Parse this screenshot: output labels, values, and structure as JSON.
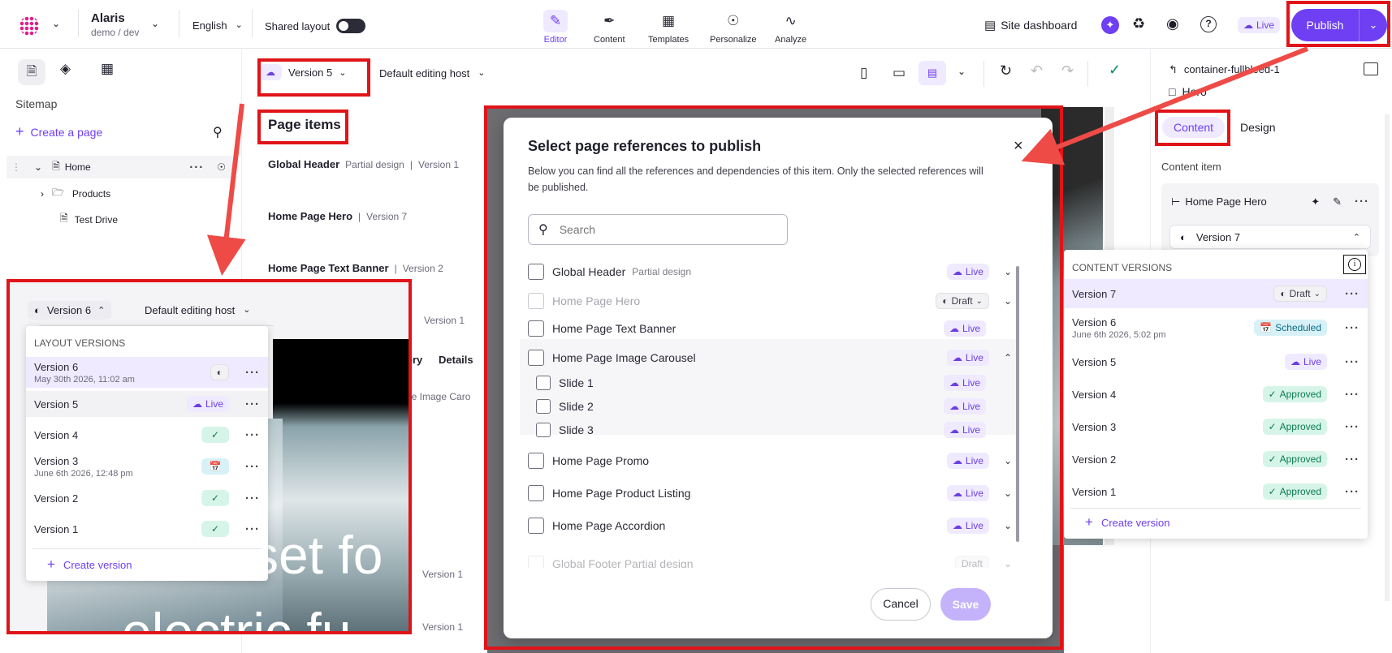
{
  "header": {
    "app_name": "Alaris",
    "app_sub": "demo / dev",
    "language": "English",
    "shared_layout": "Shared layout",
    "nav": [
      "Editor",
      "Content",
      "Templates",
      "Personalize",
      "Analyze"
    ],
    "site_dashboard": "Site dashboard",
    "live_badge": "Live",
    "publish": "Publish"
  },
  "sidebar": {
    "section": "Sitemap",
    "create_page": "Create a page",
    "tree": [
      "Home",
      "Products",
      "Test Drive"
    ]
  },
  "toolbar": {
    "version": "Version 5",
    "editing_host": "Default editing host"
  },
  "page_items": {
    "title": "Page items",
    "items": [
      {
        "name": "Global Header",
        "tag": "Partial design",
        "version": "Version 1"
      },
      {
        "name": "Home Page Hero",
        "tag": "",
        "version": "Version 7"
      },
      {
        "name": "Home Page Text Banner",
        "tag": "",
        "version": "Version 2"
      }
    ],
    "bg_fragments": [
      "Version 1",
      "ory",
      "Details",
      "ge Image Caro",
      "Version 1",
      "Version 1",
      "Version 1",
      "Live"
    ]
  },
  "layout_versions": {
    "selector": "Version 6",
    "editing_host": "Default editing host",
    "heading": "LAYOUT VERSIONS",
    "items": [
      {
        "name": "Version 6",
        "sub": "May 30th 2026, 11:02 am",
        "state": "draft"
      },
      {
        "name": "Version 5",
        "sub": "",
        "state": "live",
        "label": "Live"
      },
      {
        "name": "Version 4",
        "sub": "",
        "state": "approved"
      },
      {
        "name": "Version 3",
        "sub": "June 6th 2026, 12:48 pm",
        "state": "scheduled"
      },
      {
        "name": "Version 2",
        "sub": "",
        "state": "approved"
      },
      {
        "name": "Version 1",
        "sub": "",
        "state": "approved"
      }
    ],
    "create": "Create version",
    "hero_text_1": "set fo",
    "hero_text_2": "electric fu"
  },
  "modal": {
    "title": "Select page references to publish",
    "description": "Below you can find all the references and dependencies of this item. Only the selected references will be published.",
    "search_placeholder": "Search",
    "rows": [
      {
        "name": "Global Header",
        "tag": "Partial design",
        "status": "Live",
        "chev": "down"
      },
      {
        "name": "Home Page Hero",
        "tag": "",
        "status": "Draft",
        "chev": "down",
        "disabled": true
      },
      {
        "name": "Home Page Text Banner",
        "tag": "",
        "status": "Live",
        "chev": ""
      },
      {
        "name": "Home Page Image Carousel",
        "tag": "",
        "status": "Live",
        "chev": "up"
      },
      {
        "name": "Slide 1",
        "tag": "",
        "status": "Live",
        "chev": ""
      },
      {
        "name": "Slide 2",
        "tag": "",
        "status": "Live",
        "chev": ""
      },
      {
        "name": "Slide 3",
        "tag": "",
        "status": "Live",
        "chev": ""
      },
      {
        "name": "Home Page Promo",
        "tag": "",
        "status": "Live",
        "chev": "down"
      },
      {
        "name": "Home Page Product Listing",
        "tag": "",
        "status": "Live",
        "chev": "down"
      },
      {
        "name": "Home Page Accordion",
        "tag": "",
        "status": "Live",
        "chev": "down"
      },
      {
        "name": "Global Footer Partial design",
        "tag": "",
        "status": "Draft",
        "chev": "down",
        "disabled": true
      }
    ],
    "cancel": "Cancel",
    "save": "Save"
  },
  "right_panel": {
    "breadcrumb": "container-fullbleed-1",
    "component": "Hero",
    "tabs": [
      "Content",
      "Design"
    ],
    "content_item_label": "Content item",
    "content_item": "Home Page Hero",
    "version_select": "Version 7",
    "versions_heading": "CONTENT VERSIONS",
    "versions": [
      {
        "name": "Version 7",
        "sub": "",
        "status": "Draft"
      },
      {
        "name": "Version 6",
        "sub": "June 6th 2026, 5:02 pm",
        "status": "Scheduled"
      },
      {
        "name": "Version 5",
        "sub": "",
        "status": "Live"
      },
      {
        "name": "Version 4",
        "sub": "",
        "status": "Approved"
      },
      {
        "name": "Version 3",
        "sub": "",
        "status": "Approved"
      },
      {
        "name": "Version 2",
        "sub": "",
        "status": "Approved"
      },
      {
        "name": "Version 1",
        "sub": "",
        "status": "Approved"
      }
    ],
    "create": "Create version"
  },
  "colors": {
    "accent": "#6e3ff3",
    "red": "#e01418",
    "live_bg": "#efeaff"
  }
}
